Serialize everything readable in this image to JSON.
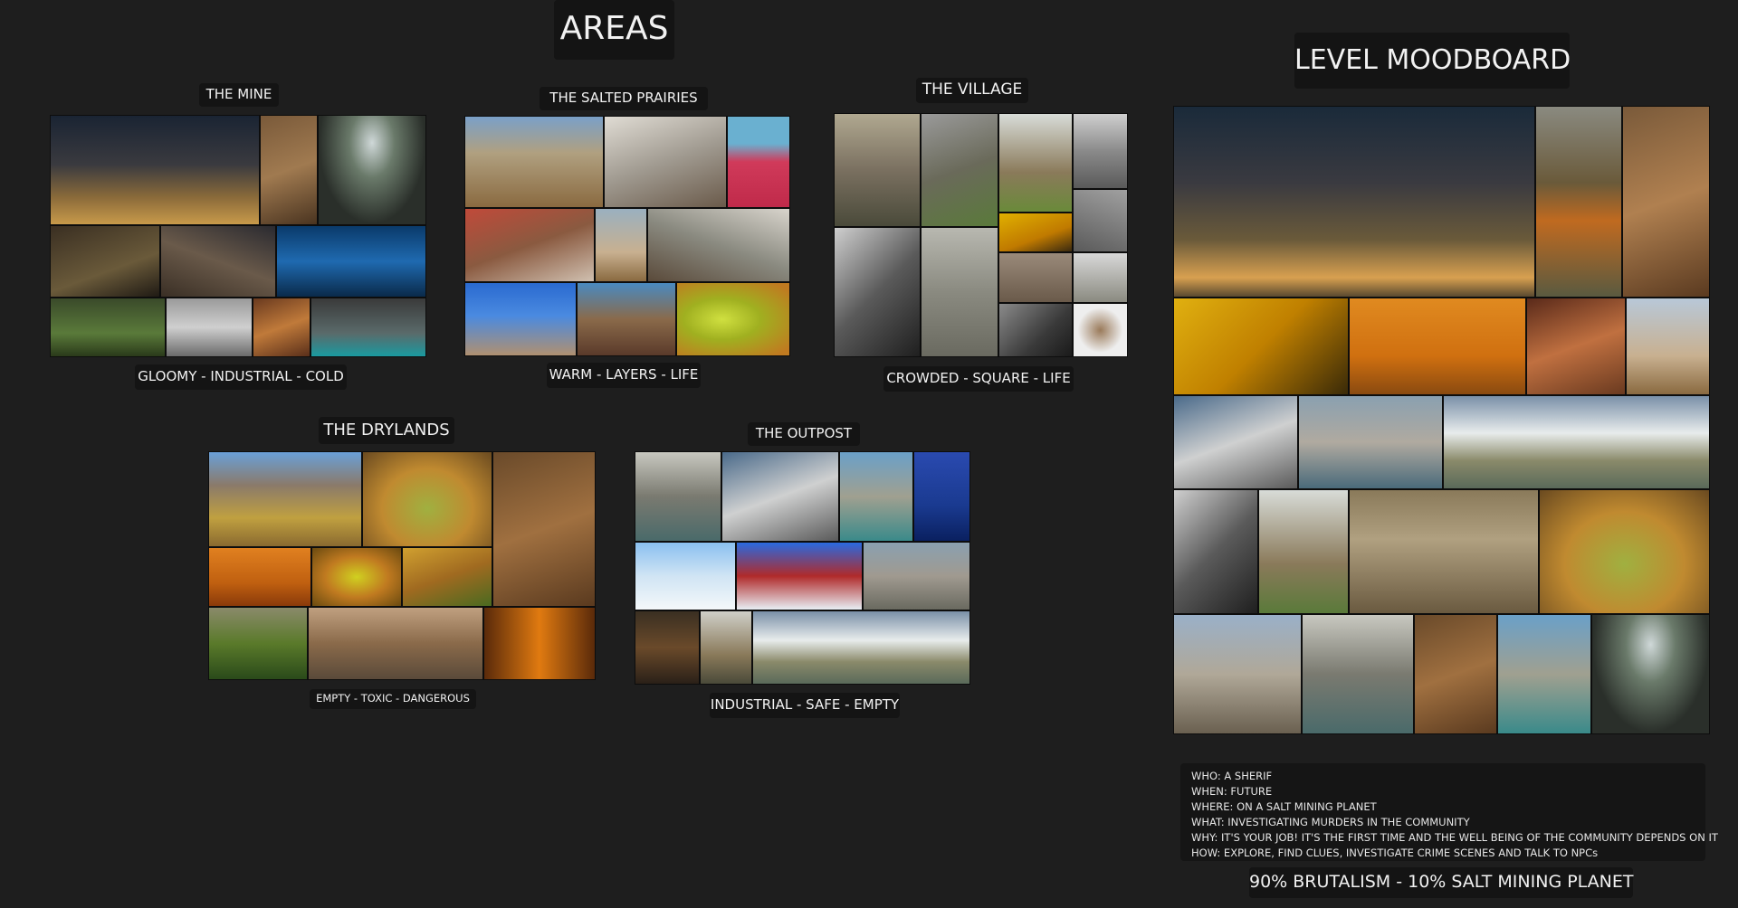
{
  "areas_title": "AREAS",
  "moodboard_title": "LEVEL MOODBOARD",
  "mine": {
    "title": "THE MINE",
    "mood": "GLOOMY - INDUSTRIAL - COLD"
  },
  "prairies": {
    "title": "THE SALTED PRAIRIES",
    "mood": "WARM - LAYERS - LIFE"
  },
  "village": {
    "title": "THE VILLAGE",
    "mood": "CROWDED - SQUARE - LIFE"
  },
  "drylands": {
    "title": "THE DRYLANDS",
    "mood": "EMPTY - TOXIC - DANGEROUS"
  },
  "outpost": {
    "title": "THE OUTPOST",
    "mood": "INDUSTRIAL - SAFE - EMPTY"
  },
  "brief": {
    "who": "WHO: A SHERIF",
    "when": "WHEN: FUTURE",
    "where": "WHERE: ON A SALT MINING PLANET",
    "what": "WHAT: INVESTIGATING MURDERS IN THE COMMUNITY",
    "why": "WHY: IT'S YOUR JOB! IT'S THE FIRST TIME AND THE WELL BEING OF THE COMMUNITY DEPENDS ON IT",
    "how": "HOW: EXPLORE, FIND CLUES, INVESTIGATE CRIME SCENES AND TALK TO NPCs"
  },
  "style_ratio": "90% BRUTALISM - 10% SALT MINING PLANET"
}
